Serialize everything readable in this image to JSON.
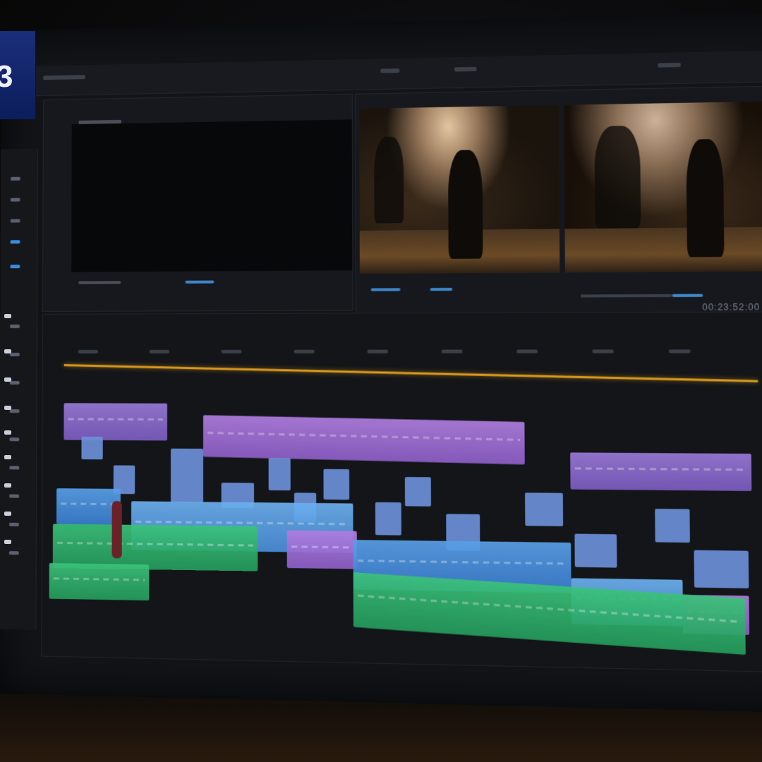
{
  "app": {
    "brand_letter": "3",
    "timecode": "00:23:52:00",
    "accent_colors": {
      "playhead": "#d99a1e",
      "clip_purple": "#9a7ad8",
      "clip_blue": "#5aa0e8",
      "clip_green": "#3bc27a",
      "ui_blue": "#3f85c8"
    }
  },
  "panels": {
    "source": {
      "name": "source-monitor"
    },
    "program": {
      "name": "program-monitor"
    }
  },
  "timeline": {
    "tracks": [
      "video-track-3",
      "video-track-2",
      "video-track-1",
      "audio-track-1",
      "audio-track-2"
    ]
  }
}
